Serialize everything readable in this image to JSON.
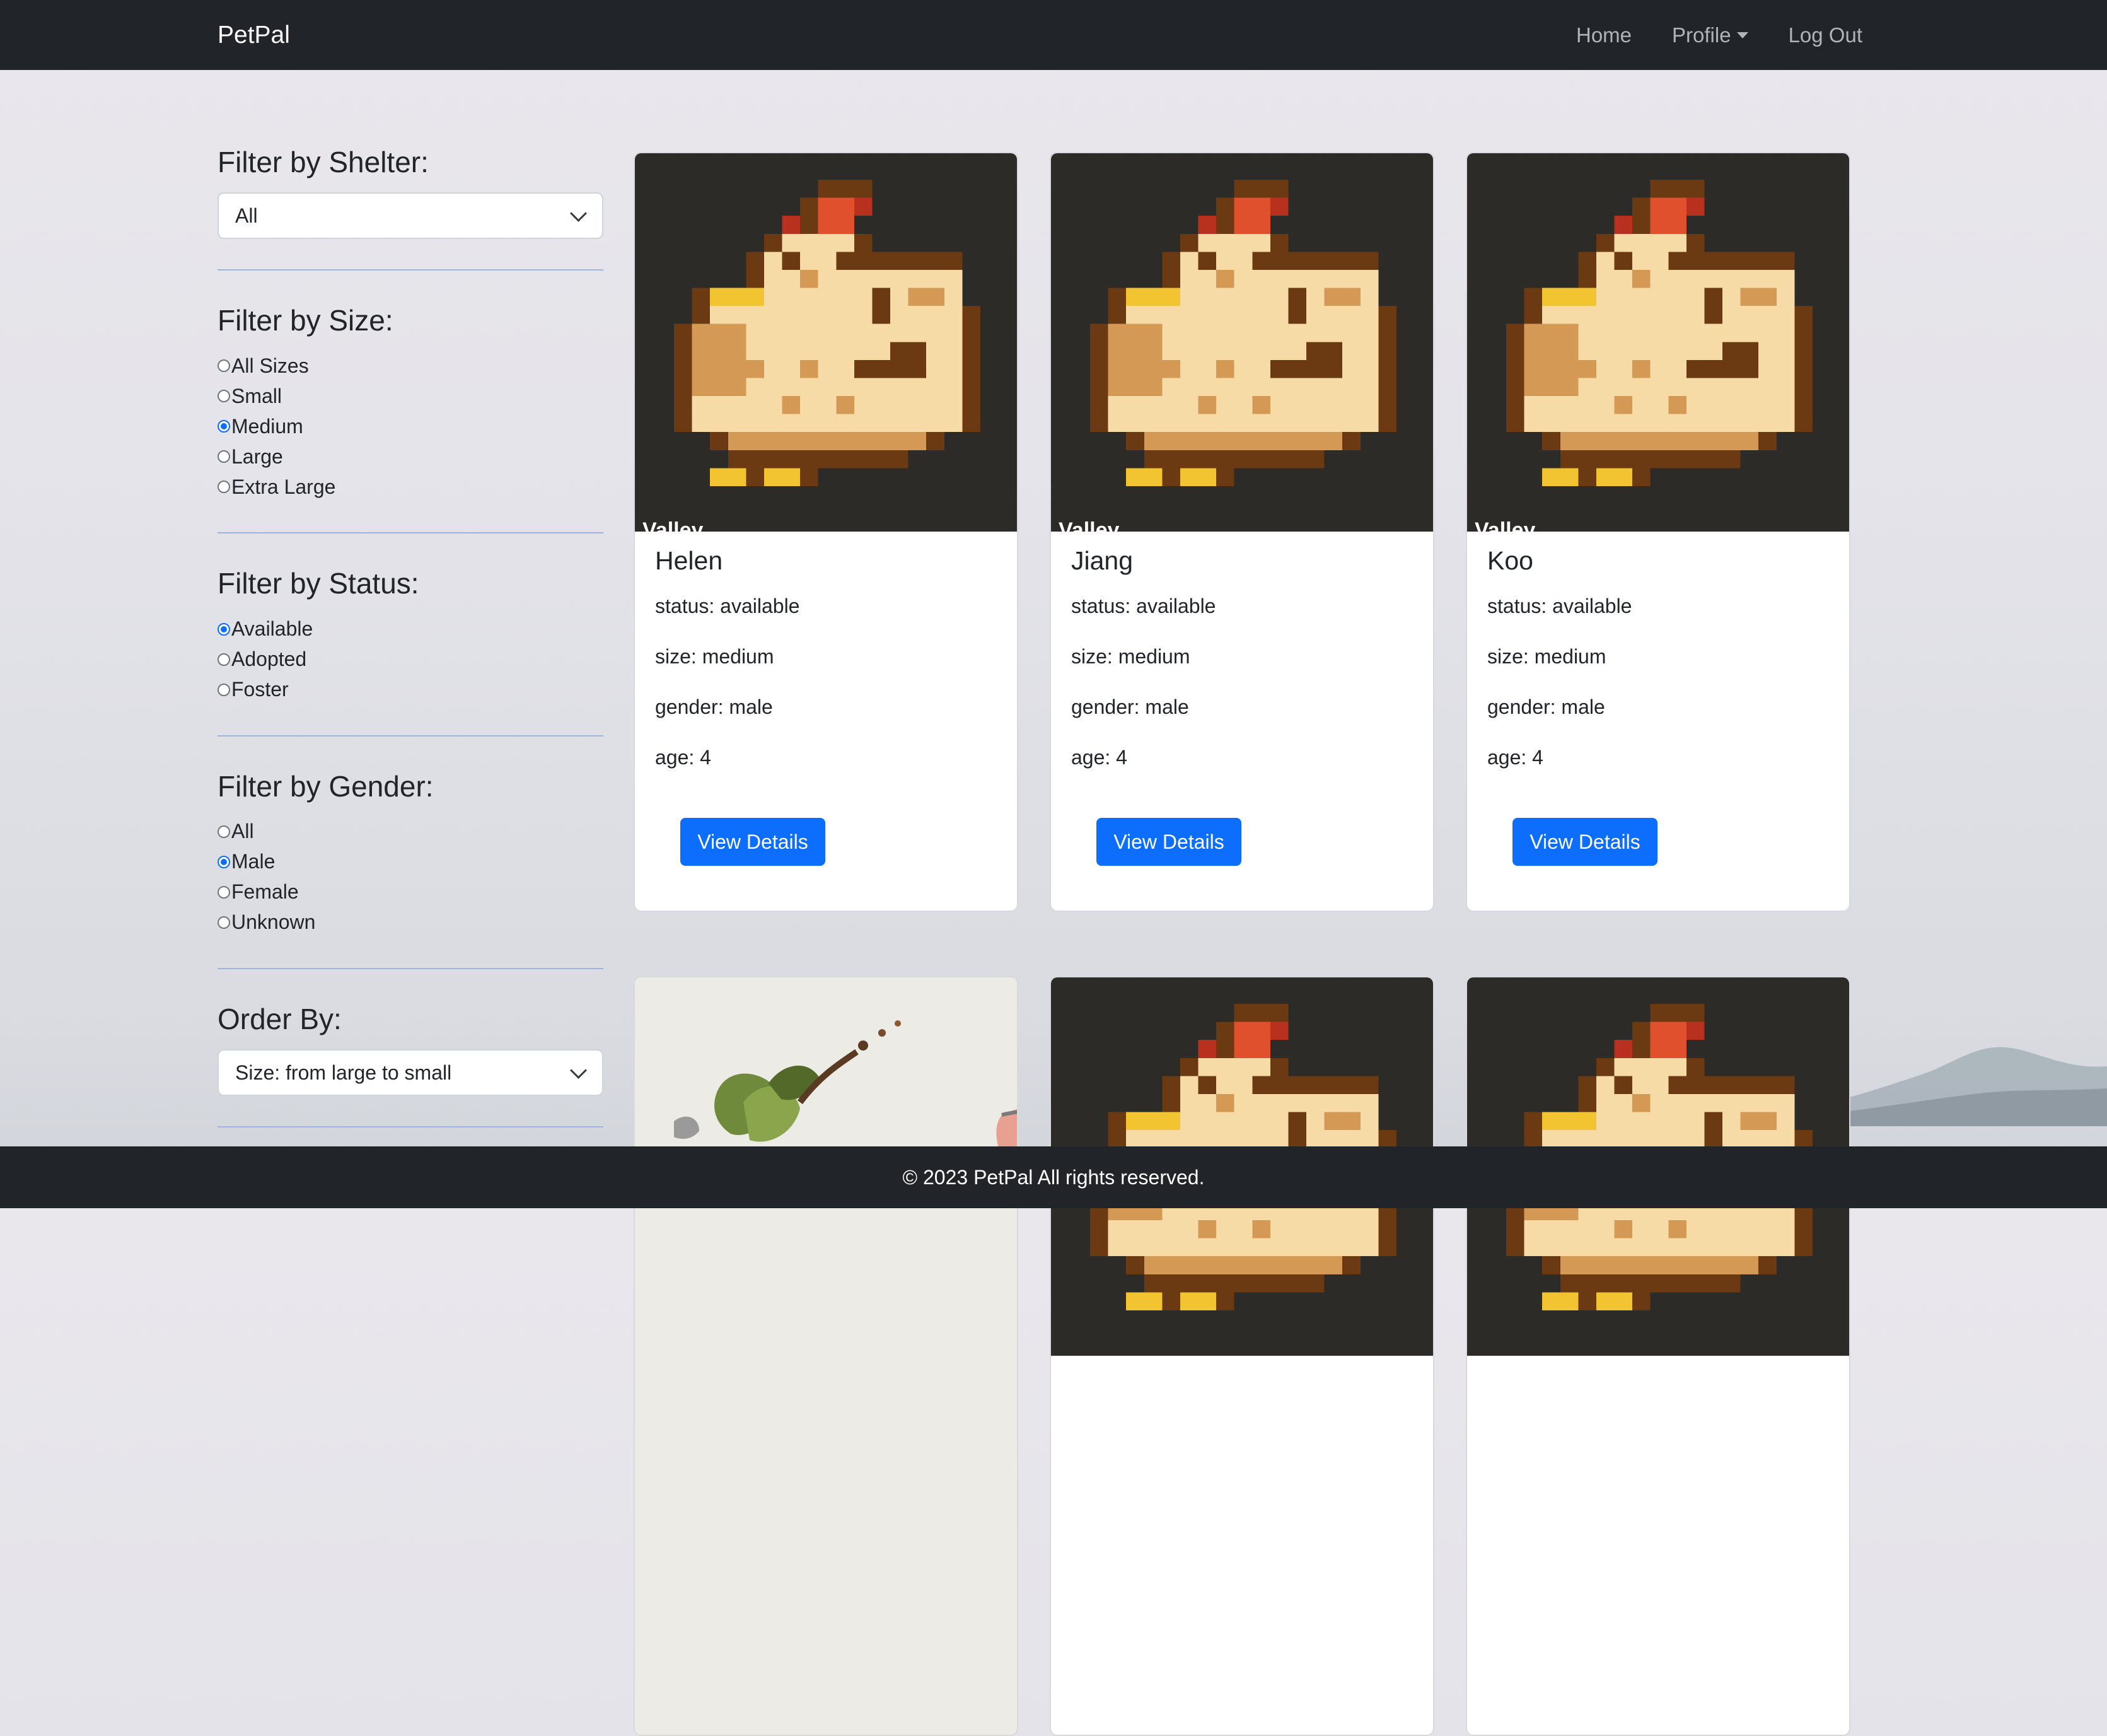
{
  "navbar": {
    "brand": "PetPal",
    "links": {
      "home": "Home",
      "profile": "Profile",
      "logout": "Log Out"
    }
  },
  "sidebar": {
    "shelter": {
      "title": "Filter by Shelter:",
      "selected": "All"
    },
    "size": {
      "title": "Filter by Size:",
      "options": [
        "All Sizes",
        "Small",
        "Medium",
        "Large",
        "Extra Large"
      ],
      "selected": "Medium"
    },
    "status": {
      "title": "Filter by Status:",
      "options": [
        "Available",
        "Adopted",
        "Foster"
      ],
      "selected": "Available"
    },
    "gender": {
      "title": "Filter by Gender:",
      "options": [
        "All",
        "Male",
        "Female",
        "Unknown"
      ],
      "selected": "Male"
    },
    "order": {
      "title": "Order By:",
      "selected": "Size: from large to small"
    }
  },
  "pets": [
    {
      "name": "Helen",
      "status": "status: available",
      "size": "size: medium",
      "gender": "gender: male",
      "age": "age: 4",
      "button": "View Details",
      "caption": "Valley"
    },
    {
      "name": "Jiang",
      "status": "status: available",
      "size": "size: medium",
      "gender": "gender: male",
      "age": "age: 4",
      "button": "View Details",
      "caption": "Valley"
    },
    {
      "name": "Koo",
      "status": "status: available",
      "size": "size: medium",
      "gender": "gender: male",
      "age": "age: 4",
      "button": "View Details",
      "caption": "Valley"
    }
  ],
  "icons": {
    "chicken": "chicken-pixel-icon",
    "dropdown": "chevron-down-icon",
    "caret": "caret-down-icon"
  },
  "colors": {
    "navbar": "#212529",
    "accent": "#0d6efd",
    "image_bg": "#2d2b28"
  },
  "footer": {
    "text": "© 2023 PetPal All rights reserved."
  }
}
